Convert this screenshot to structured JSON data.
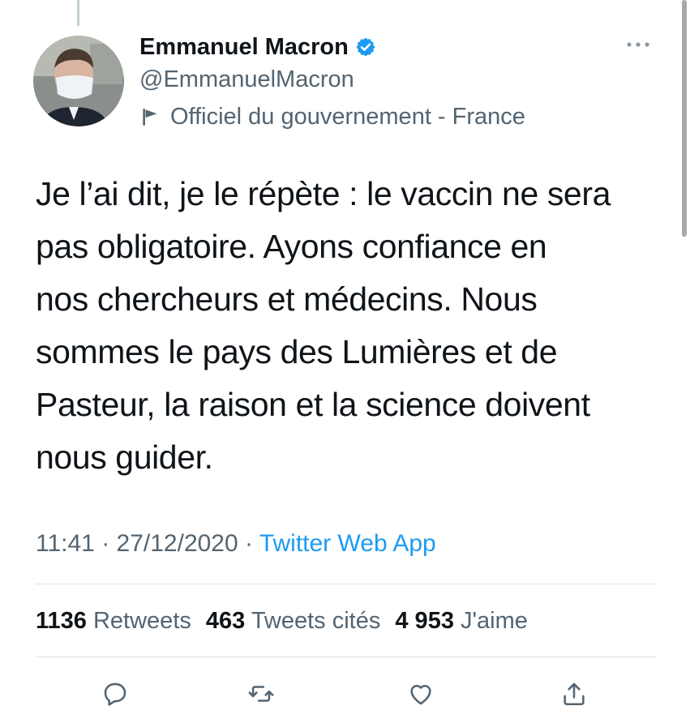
{
  "author": {
    "display_name": "Emmanuel Macron",
    "handle": "@EmmanuelMacron",
    "verified": true,
    "affiliation_label": "Officiel du gouvernement - France"
  },
  "tweet": {
    "text_lines": [
      "Je l’ai dit, je le répète : le vaccin ne sera",
      "pas obligatoire. Ayons confiance en",
      "nos chercheurs et médecins. Nous",
      "sommes le pays des Lumières et de",
      "Pasteur, la raison et la science doivent",
      "nous guider."
    ],
    "time": "11:41",
    "separator": " · ",
    "date": "27/12/2020",
    "source": "Twitter Web App"
  },
  "stats": {
    "retweets_count": "1136",
    "retweets_label": "Retweets",
    "quotes_count": "463",
    "quotes_label": "Tweets cités",
    "likes_count": "4 953",
    "likes_label": "J'aime"
  },
  "icons": {
    "verified": "verified-badge-icon",
    "flag": "flag-icon",
    "more": "more-options-icon",
    "reply": "reply-icon",
    "retweet": "retweet-icon",
    "like": "heart-icon",
    "share": "share-icon"
  },
  "colors": {
    "accent": "#1d9bf0",
    "secondary_text": "#536471",
    "primary_text": "#0f1419",
    "divider": "#dfe3e6"
  }
}
